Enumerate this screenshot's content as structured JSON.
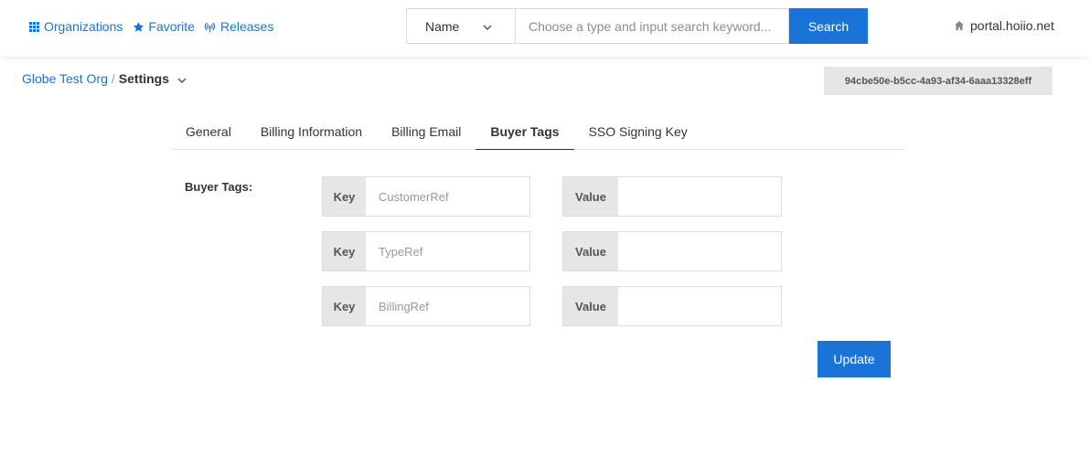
{
  "nav": {
    "organizations": "Organizations",
    "favorite": "Favorite",
    "releases": "Releases"
  },
  "search": {
    "type_selected": "Name",
    "placeholder": "Choose a type and input search keyword...",
    "button": "Search"
  },
  "portal": "portal.hoiio.net",
  "breadcrumb": {
    "org": "Globe Test Org",
    "separator": "/",
    "current": "Settings"
  },
  "org_id": "94cbe50e-b5cc-4a93-af34-6aaa13328eff",
  "tabs": [
    {
      "label": "General",
      "active": false
    },
    {
      "label": "Billing Information",
      "active": false
    },
    {
      "label": "Billing Email",
      "active": false
    },
    {
      "label": "Buyer Tags",
      "active": true
    },
    {
      "label": "SSO Signing Key",
      "active": false
    }
  ],
  "buyer_tags": {
    "label": "Buyer Tags:",
    "key_label": "Key",
    "value_label": "Value",
    "rows": [
      {
        "key_placeholder": "CustomerRef",
        "value": ""
      },
      {
        "key_placeholder": "TypeRef",
        "value": ""
      },
      {
        "key_placeholder": "BillingRef",
        "value": ""
      }
    ]
  },
  "update_button": "Update",
  "colors": {
    "accent": "#1a73d6",
    "label_bg": "#e6e6e6"
  }
}
